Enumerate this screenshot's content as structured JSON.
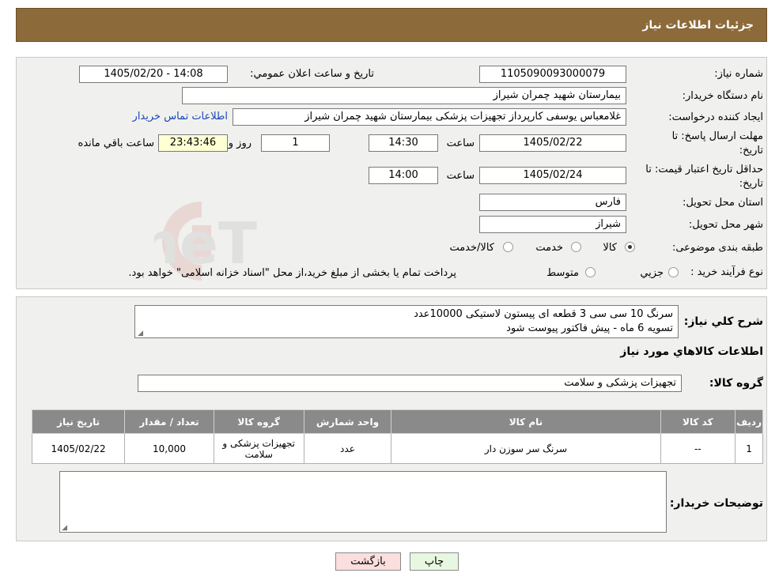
{
  "header": {
    "title": "جزئیات اطلاعات نیاز"
  },
  "watermark": {
    "text": "AriaTender.neT"
  },
  "form": {
    "need_number": {
      "label": "شماره نیاز:",
      "value": "1105090093000079"
    },
    "announce_datetime": {
      "label": "تاریخ و ساعت اعلان عمومي:",
      "value": "1405/02/20 - 14:08"
    },
    "buyer_org": {
      "label": "نام دستگاه خريدار:",
      "value": "بیمارستان شهید چمران شیراز"
    },
    "requester": {
      "label": "ايجاد کننده درخواست:",
      "value": "غلامعباس  یوسفی کارپرداز تجهیزات پزشکی بیمارستان شهید چمران شیراز"
    },
    "contact_link": "اطلاعات تماس خريدار",
    "send_deadline": {
      "label_line1": "مهلت ارسال پاسخ: تا",
      "label_line2": "تاريخ:",
      "date": "1405/02/22",
      "time_label": "ساعت",
      "time": "14:30",
      "days": "1",
      "days_label": "روز و",
      "remaining": "23:43:46",
      "remaining_label": "ساعت باقي مانده"
    },
    "price_validity": {
      "label_line1": "حداقل تاريخ اعتبار قيمت: تا",
      "label_line2": "تاريخ:",
      "date": "1405/02/24",
      "time_label": "ساعت",
      "time": "14:00"
    },
    "province": {
      "label": "استان محل تحويل:",
      "value": "فارس"
    },
    "city": {
      "label": "شهر محل تحويل:",
      "value": "شیراز"
    },
    "category": {
      "label": "طبقه بندی موضوعی:",
      "options": [
        "کالا",
        "خدمت",
        "کالا/خدمت"
      ],
      "selected": "کالا"
    },
    "purchase_type": {
      "label": "نوع فرآيند خريد :",
      "options": [
        "جزيي",
        "متوسط"
      ],
      "note": "پرداخت تمام يا بخشی از مبلغ خريد،از محل \"اسناد خزانه اسلامی\" خواهد بود."
    }
  },
  "description": {
    "label": "شرح کلي نياز:",
    "line1": "سرنگ 10 سی سی 3 قطعه ای پیستون لاستیکی 10000عدد",
    "line2": "تسویه 6 ماه - پیش فاکتور پیوست شود"
  },
  "goods_section": {
    "title": "اطلاعات کالاهاي مورد نياز",
    "group_label": "گروه کالا:",
    "group_value": "تجهیزات پزشکی و سلامت"
  },
  "table": {
    "headers": [
      "رديف",
      "کد کالا",
      "نام کالا",
      "واحد شمارش",
      "گروه کالا",
      "تعداد / مقدار",
      "تاريخ نياز"
    ],
    "rows": [
      [
        "1",
        "--",
        "سرنگ سر سوزن دار",
        "عدد",
        "تجهیزات پزشکی و سلامت",
        "10,000",
        "1405/02/22"
      ]
    ]
  },
  "buyer_notes": {
    "label": "توضيحات خريدار:",
    "value": ""
  },
  "buttons": {
    "print": "چاپ",
    "back": "بازگشت"
  }
}
